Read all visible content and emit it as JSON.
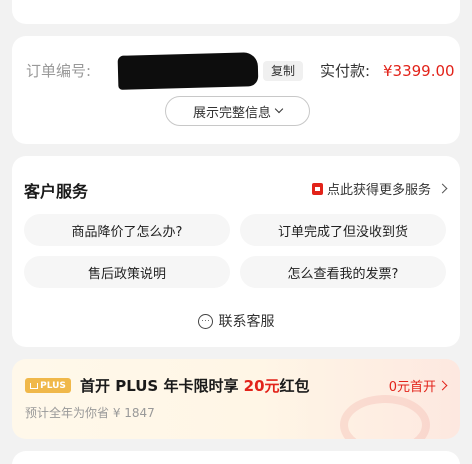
{
  "order": {
    "number_label": "订单编号:",
    "copy_label": "复制",
    "paid_label": "实付款:",
    "paid_amount": "¥3399.00",
    "expand_label": "展示完整信息"
  },
  "service": {
    "title": "客户服务",
    "more_label": "点此获得更多服务",
    "questions": [
      "商品降价了怎么办?",
      "订单完成了但没收到货",
      "售后政策说明",
      "怎么查看我的发票?"
    ],
    "contact_label": "联系客服"
  },
  "plus": {
    "badge": "PLUS",
    "title_prefix": "首开 PLUS 年卡限时享 ",
    "title_highlight": "20元",
    "title_suffix": "红包",
    "subtitle": "预计全年为你省 ¥ 1847",
    "cta": "0元首开"
  },
  "colors": {
    "accent": "#e2231a",
    "background": "#f2f2f2",
    "plus_gold": "#f0b84a"
  }
}
